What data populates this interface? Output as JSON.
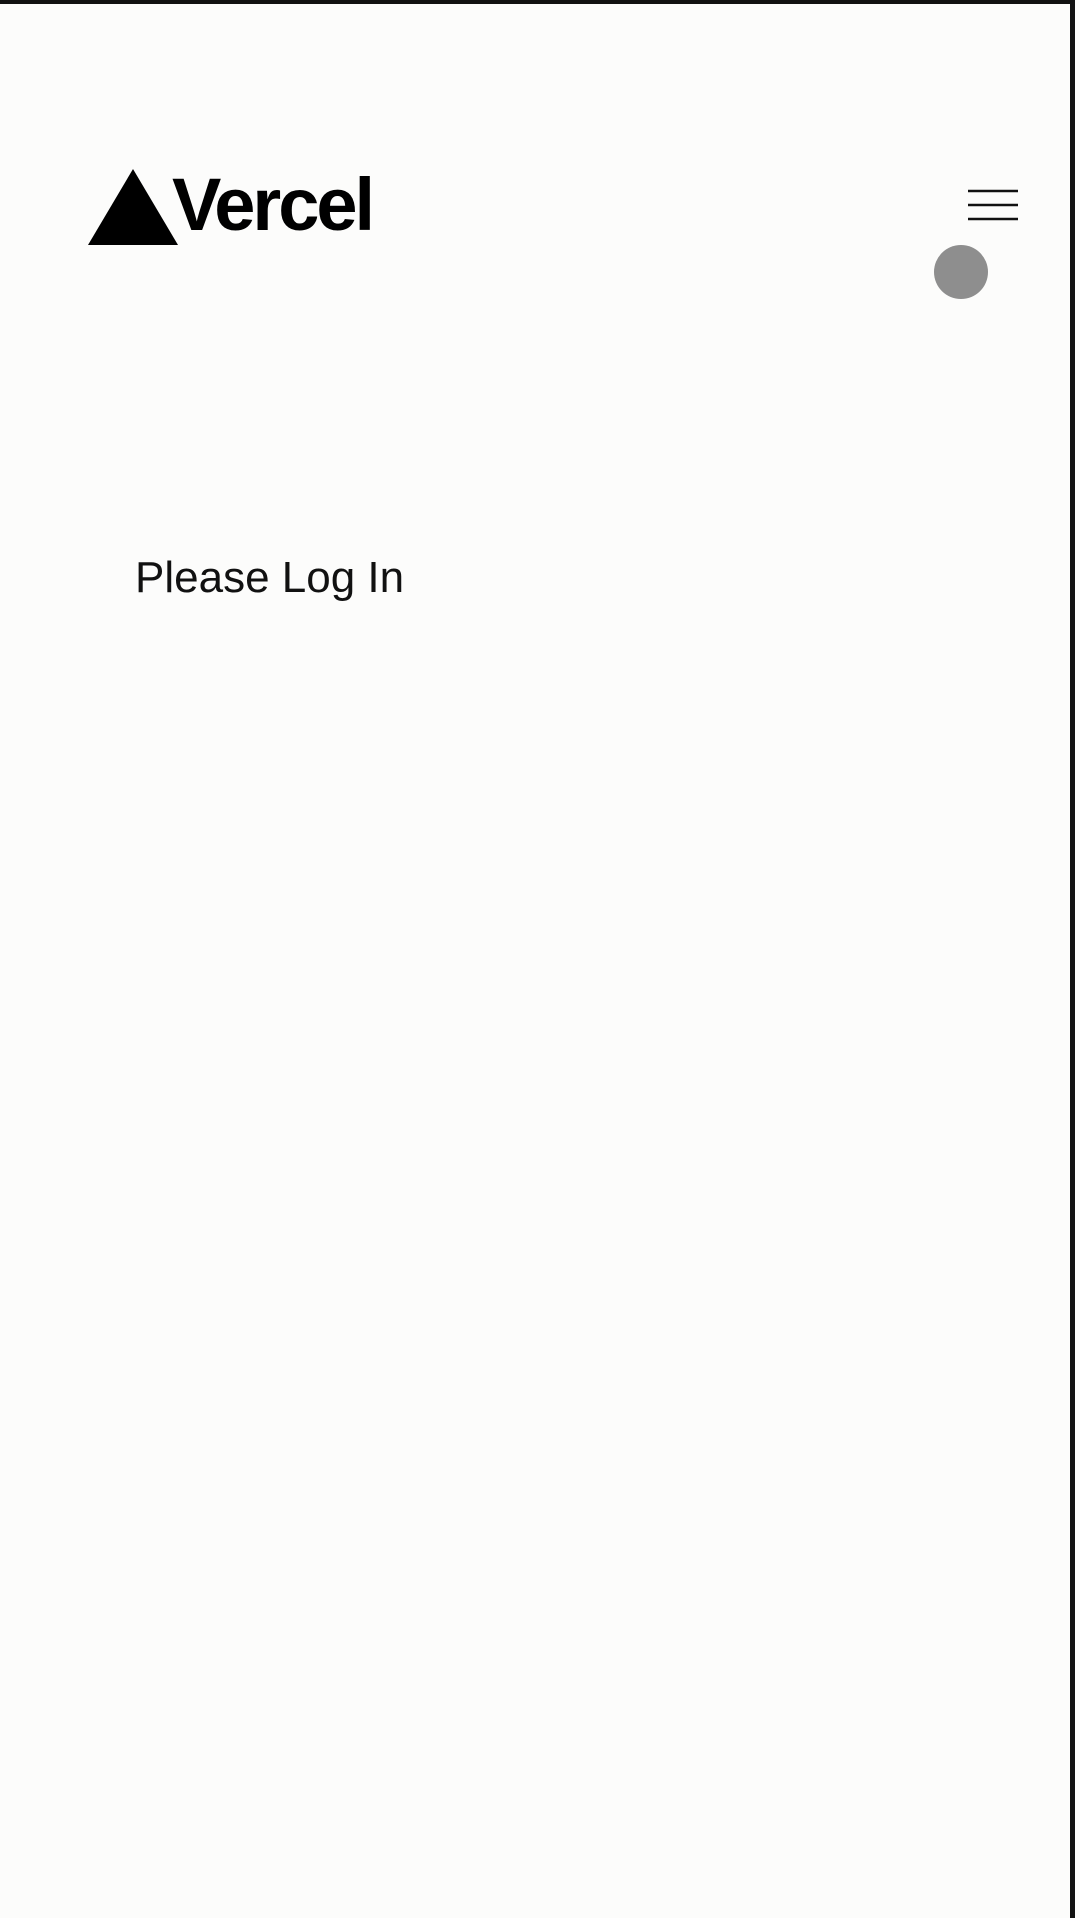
{
  "header": {
    "logo": {
      "icon": "vercel-triangle-icon",
      "wordmark": "Vercel"
    },
    "menu_button": {
      "icon": "hamburger-menu-icon"
    }
  },
  "main": {
    "message": "Please Log In"
  },
  "colors": {
    "background": "#fcfcfb",
    "text": "#111111",
    "logo": "#000000",
    "cursor_indicator": "#8e8e8e",
    "frame_border": "#111111"
  }
}
